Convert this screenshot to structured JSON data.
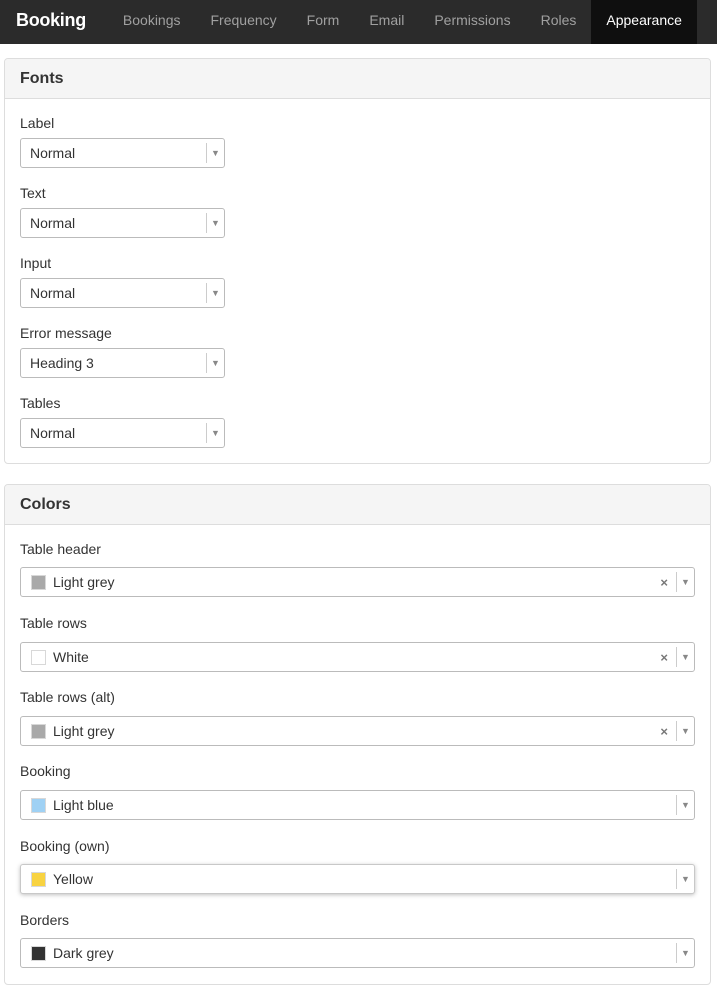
{
  "nav": {
    "brand": "Booking",
    "tabs": [
      {
        "label": "Bookings"
      },
      {
        "label": "Frequency"
      },
      {
        "label": "Form"
      },
      {
        "label": "Email"
      },
      {
        "label": "Permissions"
      },
      {
        "label": "Roles"
      },
      {
        "label": "Appearance",
        "active": true
      }
    ]
  },
  "fonts": {
    "heading": "Fonts",
    "fields": [
      {
        "label": "Label",
        "value": "Normal"
      },
      {
        "label": "Text",
        "value": "Normal"
      },
      {
        "label": "Input",
        "value": "Normal"
      },
      {
        "label": "Error message",
        "value": "Heading 3"
      },
      {
        "label": "Tables",
        "value": "Normal"
      }
    ]
  },
  "colors": {
    "heading": "Colors",
    "fields": [
      {
        "label": "Table header",
        "value": "Light grey",
        "swatch": "#a9a9a9",
        "clearable": true
      },
      {
        "label": "Table rows",
        "value": "White",
        "swatch": "#ffffff",
        "clearable": true
      },
      {
        "label": "Table rows (alt)",
        "value": "Light grey",
        "swatch": "#a9a9a9",
        "clearable": true
      },
      {
        "label": "Booking",
        "value": "Light blue",
        "swatch": "#9fd1f4",
        "clearable": false
      },
      {
        "label": "Booking (own)",
        "value": "Yellow",
        "swatch": "#f8d341",
        "clearable": false
      },
      {
        "label": "Borders",
        "value": "Dark grey",
        "swatch": "#333333",
        "clearable": false
      }
    ],
    "clear_glyph": "×"
  },
  "icons": {
    "dropdown_arrow": "▼"
  }
}
